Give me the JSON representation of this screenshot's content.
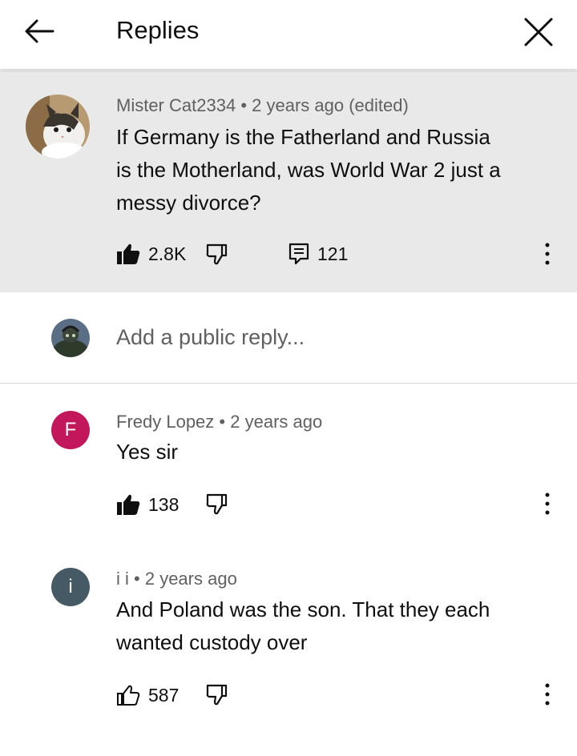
{
  "header": {
    "title": "Replies"
  },
  "parent_comment": {
    "author": "Mister Cat2334",
    "time": "2 years ago (edited)",
    "text_lines": [
      "If Germany is the Fatherland and Russia",
      "is the Motherland, was World War 2 just a",
      "messy divorce?"
    ],
    "likes": "2.8K",
    "replies_count": "121"
  },
  "reply_box": {
    "placeholder": "Add a public reply..."
  },
  "replies": [
    {
      "author": "Fredy Lopez",
      "time": "2 years ago",
      "avatar_letter": "F",
      "avatar_color": "#c2185b",
      "text_lines": [
        "Yes sir"
      ],
      "likes": "138"
    },
    {
      "author": "i i",
      "time": "2 years ago",
      "avatar_letter": "i",
      "avatar_color": "#455a64",
      "text_lines": [
        "And Poland was the son. That they each",
        "wanted custody over"
      ],
      "likes": "587"
    }
  ],
  "separator": "•",
  "colors": {
    "parent_bg": "#e9e9e9",
    "meta_text": "#606060",
    "primary_text": "#0f0f0f"
  }
}
